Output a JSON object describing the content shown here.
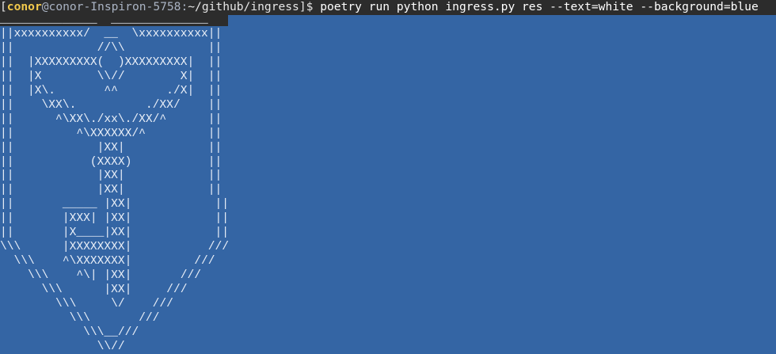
{
  "terminal": {
    "prompt": {
      "open_bracket": "[",
      "user": "conor",
      "at": "@",
      "host": "conor-Inspiron-5758",
      "separator": ":",
      "path": "~/github/ingress",
      "close": "]$ ",
      "command": "poetry run python ingress.py res --text=white --background=blue"
    },
    "colors": {
      "terminal_background": "#2c2c2c",
      "output_background": "#3465a4",
      "output_text": "#e8eef7",
      "user": "#f2c94c"
    },
    "output_lines": [
      "______________  ______________",
      "||xxxxxxxxxx/  __  \\xxxxxxxxxx||",
      "||            //\\\\            ||",
      "||  |XXXXXXXXX(  )XXXXXXXXX|  ||",
      "||  |X        \\\\//        X|  ||",
      "||  |X\\.       ^^       ./X|  ||",
      "||    \\XX\\.          ./XX/    ||",
      "||      ^\\XX\\./xx\\./XX/^      ||",
      "||         ^\\XXXXXX/^         ||",
      "||            |XX|            ||",
      "||           (XXXX)           ||",
      "||            |XX|            ||",
      "||            |XX|            ||",
      "||       _____ |XX|            ||",
      "||       |XXX| |XX|            ||",
      "||       |X____|XX|            ||",
      "\\\\\\      |XXXXXXXX|           ///",
      "  \\\\\\    ^\\XXXXXXX|         ///",
      "    \\\\\\    ^\\| |XX|       ///",
      "      \\\\\\      |XX|     ///",
      "        \\\\\\     \\/    ///",
      "          \\\\\\       ///",
      "            \\\\\\__///",
      "              \\\\//"
    ]
  }
}
